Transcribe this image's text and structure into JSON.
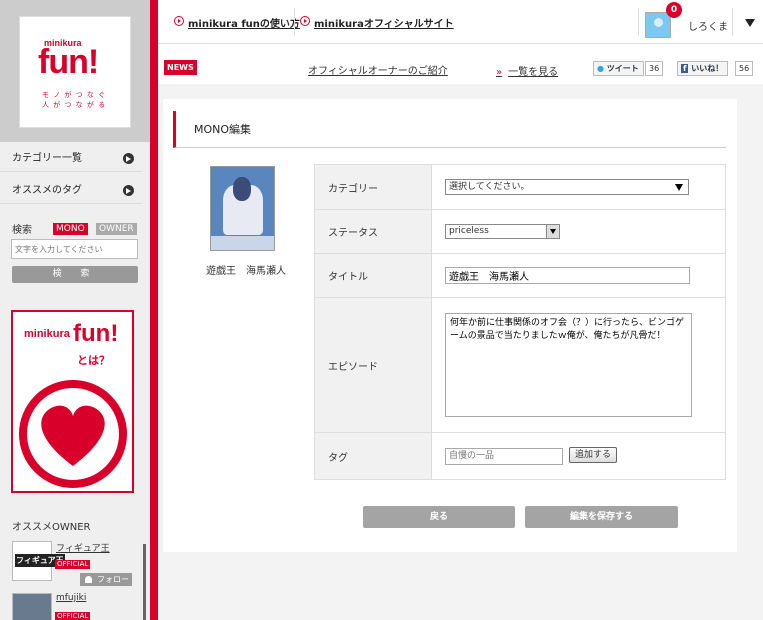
{
  "brand": {
    "small": "minikura",
    "big": "fun!",
    "tagline1": "モ ノ が つ な ぐ",
    "tagline2": "人 が つ な が る"
  },
  "sidebar": {
    "category": "カテゴリー一覧",
    "tags": "オススメのタグ",
    "search_label": "検索",
    "toggle_mono": "MONO",
    "toggle_owner": "OWNER",
    "search_placeholder": "文字を入力してください",
    "search_button": "検 索",
    "banner_small": "minikura",
    "banner_big": "fun!",
    "banner_question": "とは？",
    "owner_heading": "オススメOWNER",
    "owners": [
      {
        "name": "フィギュア王",
        "thumb": "フィギュア王",
        "badge": "OFFICIAL"
      },
      {
        "name": "mfujiki",
        "badge": "OFFICIAL"
      }
    ],
    "follow": "フォロー"
  },
  "header": {
    "link_howto": "minikura funの使い方",
    "link_official": "minikuraオフィシャルサイト",
    "notifications": "0",
    "username": "しろくま"
  },
  "news": {
    "badge": "NEWS",
    "item": "オフィシャルオーナーのご紹介",
    "arrow": "»",
    "more": "一覧を見る",
    "tweet": "ツイート",
    "tweet_count": "36",
    "like": "いいね！",
    "like_count": "56"
  },
  "page": {
    "title": "MONO編集",
    "product_caption": "遊戯王　海馬瀬人"
  },
  "form": {
    "category_label": "カテゴリー",
    "category_value": "選択してください。",
    "status_label": "ステータス",
    "status_value": "priceless",
    "title_label": "タイトル",
    "title_value": "遊戯王　海馬瀬人",
    "episode_label": "エピソード",
    "episode_value": "何年か前に仕事関係のオフ会（？）に行ったら、ビンゴゲームの景品で当たりましたｗ俺が、俺たちが凡骨だ！",
    "tag_label": "タグ",
    "tag_placeholder": "自慢の一品",
    "tag_add": "追加する"
  },
  "actions": {
    "back": "戻る",
    "save": "編集を保存する"
  },
  "colors": {
    "accent": "#d8002a",
    "button_gray": "#a4a4a4",
    "sidebar_bg": "#efefef"
  }
}
